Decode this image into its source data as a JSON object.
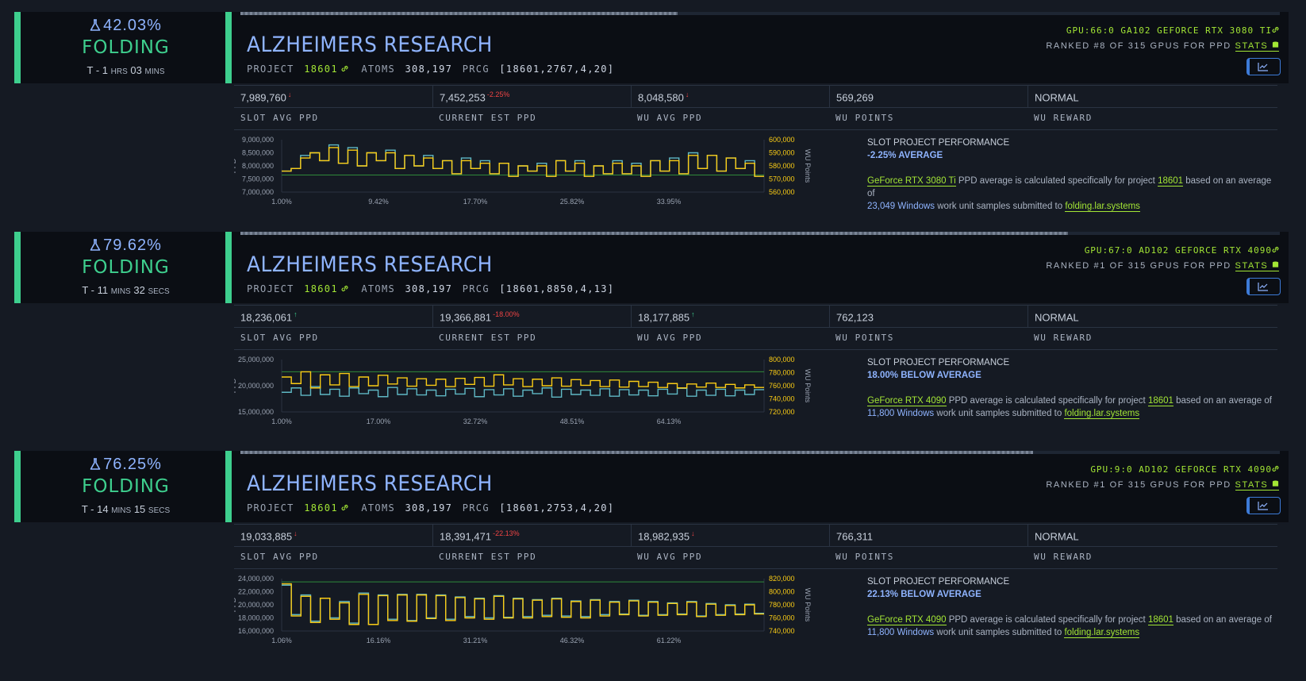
{
  "slots": [
    {
      "progress_pct": "42.03%",
      "progress_fraction": 0.4203,
      "state": "FOLDING",
      "eta": {
        "prefix": "T -",
        "n1": "1",
        "u1": "HRS",
        "n2": "03",
        "u2": "MINS"
      },
      "title": "ALZHEIMERS RESEARCH",
      "project_label": "PROJECT",
      "project": "18601",
      "atoms_label": "ATOMS",
      "atoms": "308,197",
      "prcg_label": "PRCG",
      "prcg": "[18601,2767,4,20]",
      "gpu": "GPU:66:0 GA102 GEFORCE RTX 3080 TI",
      "rank": "RANKED #8 OF 315 GPUS FOR PPD",
      "stats_label": "STATS",
      "values": [
        {
          "v": "7,989,760",
          "d": "↓",
          "dc": "red"
        },
        {
          "v": "7,452,253",
          "d": "-2.25%",
          "dc": "red"
        },
        {
          "v": "8,048,580",
          "d": "↓",
          "dc": "red"
        },
        {
          "v": "569,269",
          "d": "",
          "dc": ""
        },
        {
          "v": "NORMAL",
          "d": "",
          "dc": ""
        }
      ],
      "labels": [
        "SLOT AVG PPD",
        "CURRENT EST PPD",
        "WU AVG PPD",
        "WU POINTS",
        "WU REWARD"
      ],
      "perf_title": "SLOT PROJECT PERFORMANCE",
      "perf_value": "-2.25% AVERAGE",
      "gpu_name": "GeForce RTX 3080 Ti",
      "samples": "23,049",
      "os": "Windows",
      "site": "folding.lar.systems",
      "text1": "PPD average is calculated specifically for project",
      "text2": "based on an average of",
      "text3": "work unit samples submitted to",
      "chart_data": {
        "type": "line",
        "ylabel": "PPD",
        "y2label": "WU Points",
        "yticks": [
          "9,000,000",
          "8,500,000",
          "8,000,000",
          "7,500,000",
          "7,000,000"
        ],
        "y2ticks": [
          "600,000",
          "590,000",
          "580,000",
          "570,000",
          "560,000"
        ],
        "xticks": [
          "1.00%",
          "9.42%",
          "17.70%",
          "25.82%",
          "33.95%"
        ],
        "ylim": [
          7000000,
          9000000
        ],
        "series": [
          {
            "color": "#5fb8c4",
            "values": [
              7.8,
              7.9,
              8.4,
              8.5,
              8.2,
              8.8,
              8.1,
              8.7,
              8.0,
              8.5,
              8.2,
              8.6,
              7.9,
              8.4,
              8.0,
              8.4,
              7.9,
              8.2,
              7.7,
              8.3,
              7.9,
              8.2,
              7.7,
              8.1,
              7.6,
              8.0,
              7.8,
              8.1,
              7.6,
              8.2,
              7.8,
              8.2,
              7.6,
              8.0,
              7.7,
              8.2,
              7.7,
              8.1,
              7.6,
              8.2,
              7.8,
              8.3,
              7.7,
              8.5,
              7.9,
              8.4,
              7.8,
              8.3,
              7.9,
              8.2,
              7.6
            ]
          },
          {
            "color": "#facc15",
            "values": [
              7.8,
              7.9,
              8.3,
              8.5,
              8.2,
              8.7,
              8.1,
              8.6,
              8.0,
              8.5,
              8.2,
              8.5,
              7.9,
              8.4,
              8.0,
              8.3,
              7.9,
              8.2,
              7.7,
              8.2,
              7.9,
              8.1,
              7.7,
              8.1,
              7.6,
              8.0,
              7.8,
              8.0,
              7.6,
              8.2,
              7.8,
              8.1,
              7.6,
              8.0,
              7.7,
              8.1,
              7.7,
              8.0,
              7.6,
              8.2,
              7.8,
              8.2,
              7.7,
              8.4,
              7.9,
              8.4,
              7.8,
              8.3,
              7.9,
              8.1,
              7.6
            ]
          }
        ],
        "reference_line": 7.65
      }
    },
    {
      "progress_pct": "79.62%",
      "progress_fraction": 0.7962,
      "state": "FOLDING",
      "eta": {
        "prefix": "T -",
        "n1": "11",
        "u1": "MINS",
        "n2": "32",
        "u2": "SECS"
      },
      "title": "ALZHEIMERS RESEARCH",
      "project_label": "PROJECT",
      "project": "18601",
      "atoms_label": "ATOMS",
      "atoms": "308,197",
      "prcg_label": "PRCG",
      "prcg": "[18601,8850,4,13]",
      "gpu": "GPU:67:0 AD102 GEFORCE RTX 4090",
      "rank": "RANKED #1 OF 315 GPUS FOR PPD",
      "stats_label": "STATS",
      "values": [
        {
          "v": "18,236,061",
          "d": "↑",
          "dc": "grn"
        },
        {
          "v": "19,366,881",
          "d": "-18.00%",
          "dc": "red"
        },
        {
          "v": "18,177,885",
          "d": "↑",
          "dc": "grn"
        },
        {
          "v": "762,123",
          "d": "",
          "dc": ""
        },
        {
          "v": "NORMAL",
          "d": "",
          "dc": ""
        }
      ],
      "labels": [
        "SLOT AVG PPD",
        "CURRENT EST PPD",
        "WU AVG PPD",
        "WU POINTS",
        "WU REWARD"
      ],
      "perf_title": "SLOT PROJECT PERFORMANCE",
      "perf_value": "18.00% BELOW AVERAGE",
      "gpu_name": "GeForce RTX 4090",
      "samples": "11,800",
      "os": "Windows",
      "site": "folding.lar.systems",
      "text1": "PPD average is calculated specifically for project",
      "text2": "based on an average of",
      "text3": "work unit samples submitted to",
      "chart_data": {
        "type": "line",
        "ylabel": "PPD",
        "y2label": "WU Points",
        "yticks": [
          "25,000,000",
          "20,000,000",
          "15,000,000"
        ],
        "y2ticks": [
          "800,000",
          "780,000",
          "760,000",
          "740,000",
          "720,000"
        ],
        "xticks": [
          "1.00%",
          "17.00%",
          "32.72%",
          "48.51%",
          "64.13%"
        ],
        "ylim": [
          14000000,
          26000000
        ],
        "series": [
          {
            "color": "#5fb8c4",
            "values": [
              18.5,
              19.5,
              17.8,
              19.8,
              18.0,
              19.2,
              17.6,
              19.5,
              18.2,
              19.0,
              17.5,
              19.6,
              18.0,
              19.3,
              17.9,
              19.0,
              17.7,
              19.2,
              18.1,
              19.4,
              17.5,
              19.1,
              17.9,
              19.3,
              17.6,
              19.0,
              18.2,
              19.5,
              17.4,
              19.2,
              18.0,
              19.0,
              17.8,
              19.3,
              17.6,
              19.1,
              17.9,
              19.0,
              17.7,
              19.2,
              18.1,
              19.4,
              17.6,
              19.0,
              17.8,
              19.2,
              17.7,
              19.0,
              18.0,
              19.1
            ]
          },
          {
            "color": "#facc15",
            "values": [
              22.0,
              20.5,
              23.2,
              19.5,
              22.5,
              20.2,
              22.8,
              19.8,
              22.0,
              20.0,
              22.4,
              20.4,
              21.8,
              19.9,
              21.6,
              20.1,
              21.5,
              19.8,
              21.7,
              20.3,
              21.9,
              19.9,
              22.5,
              20.2,
              21.6,
              19.8,
              21.5,
              20.0,
              21.8,
              19.9,
              21.4,
              20.1,
              21.2,
              19.8,
              21.3,
              19.7,
              21.0,
              19.8,
              20.8,
              19.6,
              20.5,
              19.5,
              20.4,
              19.7,
              20.6,
              19.6,
              20.3,
              19.5,
              20.2,
              19.6
            ]
          }
        ],
        "reference_line": 23.2
      }
    },
    {
      "progress_pct": "76.25%",
      "progress_fraction": 0.7625,
      "state": "FOLDING",
      "eta": {
        "prefix": "T -",
        "n1": "14",
        "u1": "MINS",
        "n2": "15",
        "u2": "SECS"
      },
      "title": "ALZHEIMERS RESEARCH",
      "project_label": "PROJECT",
      "project": "18601",
      "atoms_label": "ATOMS",
      "atoms": "308,197",
      "prcg_label": "PRCG",
      "prcg": "[18601,2753,4,20]",
      "gpu": "GPU:9:0 AD102 GEFORCE RTX 4090",
      "rank": "RANKED #1 OF 315 GPUS FOR PPD",
      "stats_label": "STATS",
      "values": [
        {
          "v": "19,033,885",
          "d": "↓",
          "dc": "red"
        },
        {
          "v": "18,391,471",
          "d": "-22.13%",
          "dc": "red"
        },
        {
          "v": "18,982,935",
          "d": "↓",
          "dc": "red"
        },
        {
          "v": "766,311",
          "d": "",
          "dc": ""
        },
        {
          "v": "NORMAL",
          "d": "",
          "dc": ""
        }
      ],
      "labels": [
        "SLOT AVG PPD",
        "CURRENT EST PPD",
        "WU AVG PPD",
        "WU POINTS",
        "WU REWARD"
      ],
      "perf_title": "SLOT PROJECT PERFORMANCE",
      "perf_value": "22.13% BELOW AVERAGE",
      "gpu_name": "GeForce RTX 4090",
      "samples": "11,800",
      "os": "Windows",
      "site": "folding.lar.systems",
      "text1": "PPD average is calculated specifically for project",
      "text2": "based on an average of",
      "text3": "work unit samples submitted to",
      "chart_data": {
        "type": "line",
        "ylabel": "PPD",
        "y2label": "WU Points",
        "yticks": [
          "24,000,000",
          "22,000,000",
          "20,000,000",
          "18,000,000",
          "16,000,000"
        ],
        "y2ticks": [
          "820,000",
          "800,000",
          "780,000",
          "760,000",
          "740,000"
        ],
        "xticks": [
          "1.06%",
          "16.16%",
          "31.21%",
          "46.32%",
          "61.22%"
        ],
        "ylim": [
          16000000,
          24000000
        ],
        "series": [
          {
            "color": "#5fb8c4",
            "values": [
              23.0,
              18.5,
              21.5,
              17.5,
              21.0,
              18.0,
              20.5,
              17.2,
              21.8,
              17.0,
              21.5,
              17.8,
              21.6,
              17.6,
              21.6,
              18.0,
              21.5,
              17.8,
              21.2,
              18.2,
              21.0,
              18.0,
              21.4,
              18.1,
              21.0,
              18.2,
              20.8,
              18.4,
              21.0,
              18.3,
              20.6,
              18.2,
              20.8,
              18.5,
              20.5,
              18.6,
              20.7,
              18.4,
              20.5,
              18.5,
              20.3,
              18.6,
              20.5,
              18.3,
              20.2,
              18.5,
              20.0,
              18.6,
              20.1,
              18.7
            ]
          },
          {
            "color": "#facc15",
            "values": [
              23.2,
              18.3,
              21.3,
              17.3,
              21.0,
              17.8,
              20.3,
              17.0,
              21.6,
              17.0,
              21.4,
              17.6,
              21.5,
              17.5,
              21.5,
              17.9,
              21.4,
              17.6,
              21.1,
              18.0,
              20.9,
              17.8,
              21.3,
              18.0,
              20.9,
              18.0,
              20.7,
              18.2,
              20.9,
              18.1,
              20.5,
              18.0,
              20.7,
              18.3,
              20.4,
              18.5,
              20.6,
              18.3,
              20.4,
              18.4,
              20.2,
              18.5,
              20.4,
              18.2,
              20.1,
              18.4,
              19.9,
              18.5,
              20.0,
              18.6
            ]
          }
        ],
        "reference_line": 23.5
      }
    }
  ]
}
